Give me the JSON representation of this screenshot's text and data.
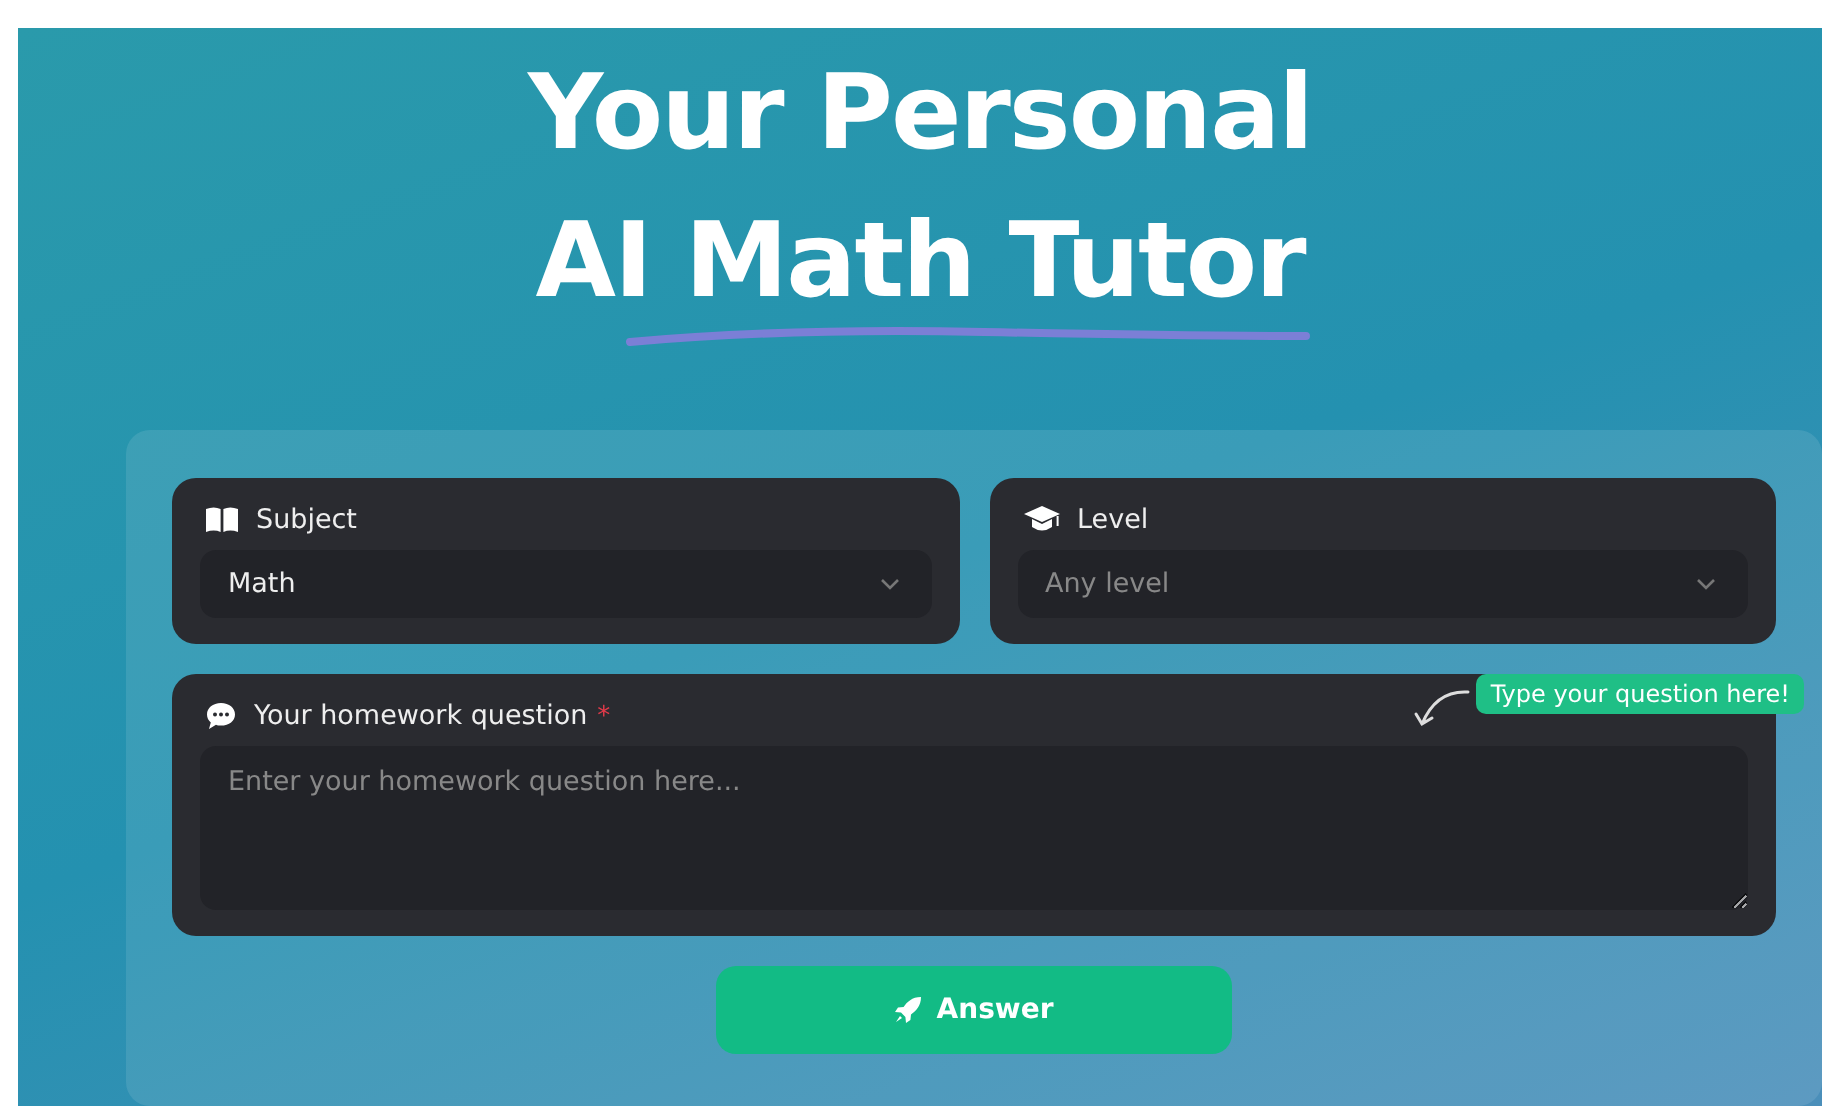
{
  "title_lines": [
    "Your Personal",
    "AI Math Tutor"
  ],
  "selects": [
    {
      "label": "Subject",
      "value": "Math",
      "is_placeholder": false
    },
    {
      "label": "Level",
      "value": "Any level",
      "is_placeholder": true
    }
  ],
  "question": {
    "label": "Your homework question",
    "required_mark": "*",
    "placeholder": "Enter your homework question here...",
    "hint": "Type your question here!"
  },
  "submit": {
    "label": "Answer"
  }
}
